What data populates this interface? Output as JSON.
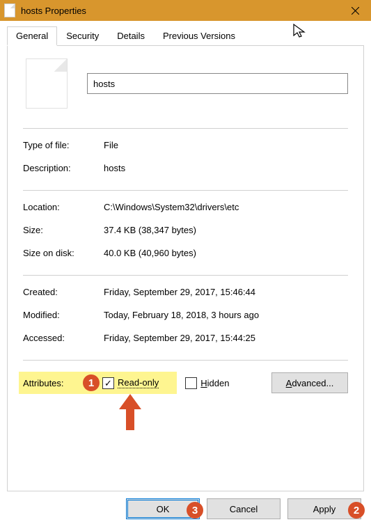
{
  "titlebar": {
    "title": "hosts Properties"
  },
  "tabs": {
    "general": "General",
    "security": "Security",
    "details": "Details",
    "previous": "Previous Versions"
  },
  "filename": "hosts",
  "props": {
    "type_label": "Type of file:",
    "type_value": "File",
    "desc_label": "Description:",
    "desc_value": "hosts",
    "location_label": "Location:",
    "location_value": "C:\\Windows\\System32\\drivers\\etc",
    "size_label": "Size:",
    "size_value": "37.4 KB (38,347 bytes)",
    "sizeondisk_label": "Size on disk:",
    "sizeondisk_value": "40.0 KB (40,960 bytes)",
    "created_label": "Created:",
    "created_value": "Friday, September 29, 2017, 15:46:44",
    "modified_label": "Modified:",
    "modified_value": "Today, February 18, 2018, 3 hours ago",
    "accessed_label": "Accessed:",
    "accessed_value": "Friday, September 29, 2017, 15:44:25"
  },
  "attributes": {
    "label": "Attributes:",
    "readonly": "Read-only",
    "hidden_h": "H",
    "hidden_rest": "idden",
    "advanced_a": "A",
    "advanced_rest": "dvanced..."
  },
  "buttons": {
    "ok": "OK",
    "cancel": "Cancel",
    "apply": "Apply"
  },
  "annotations": {
    "badge1": "1",
    "badge2": "2",
    "badge3": "3"
  }
}
